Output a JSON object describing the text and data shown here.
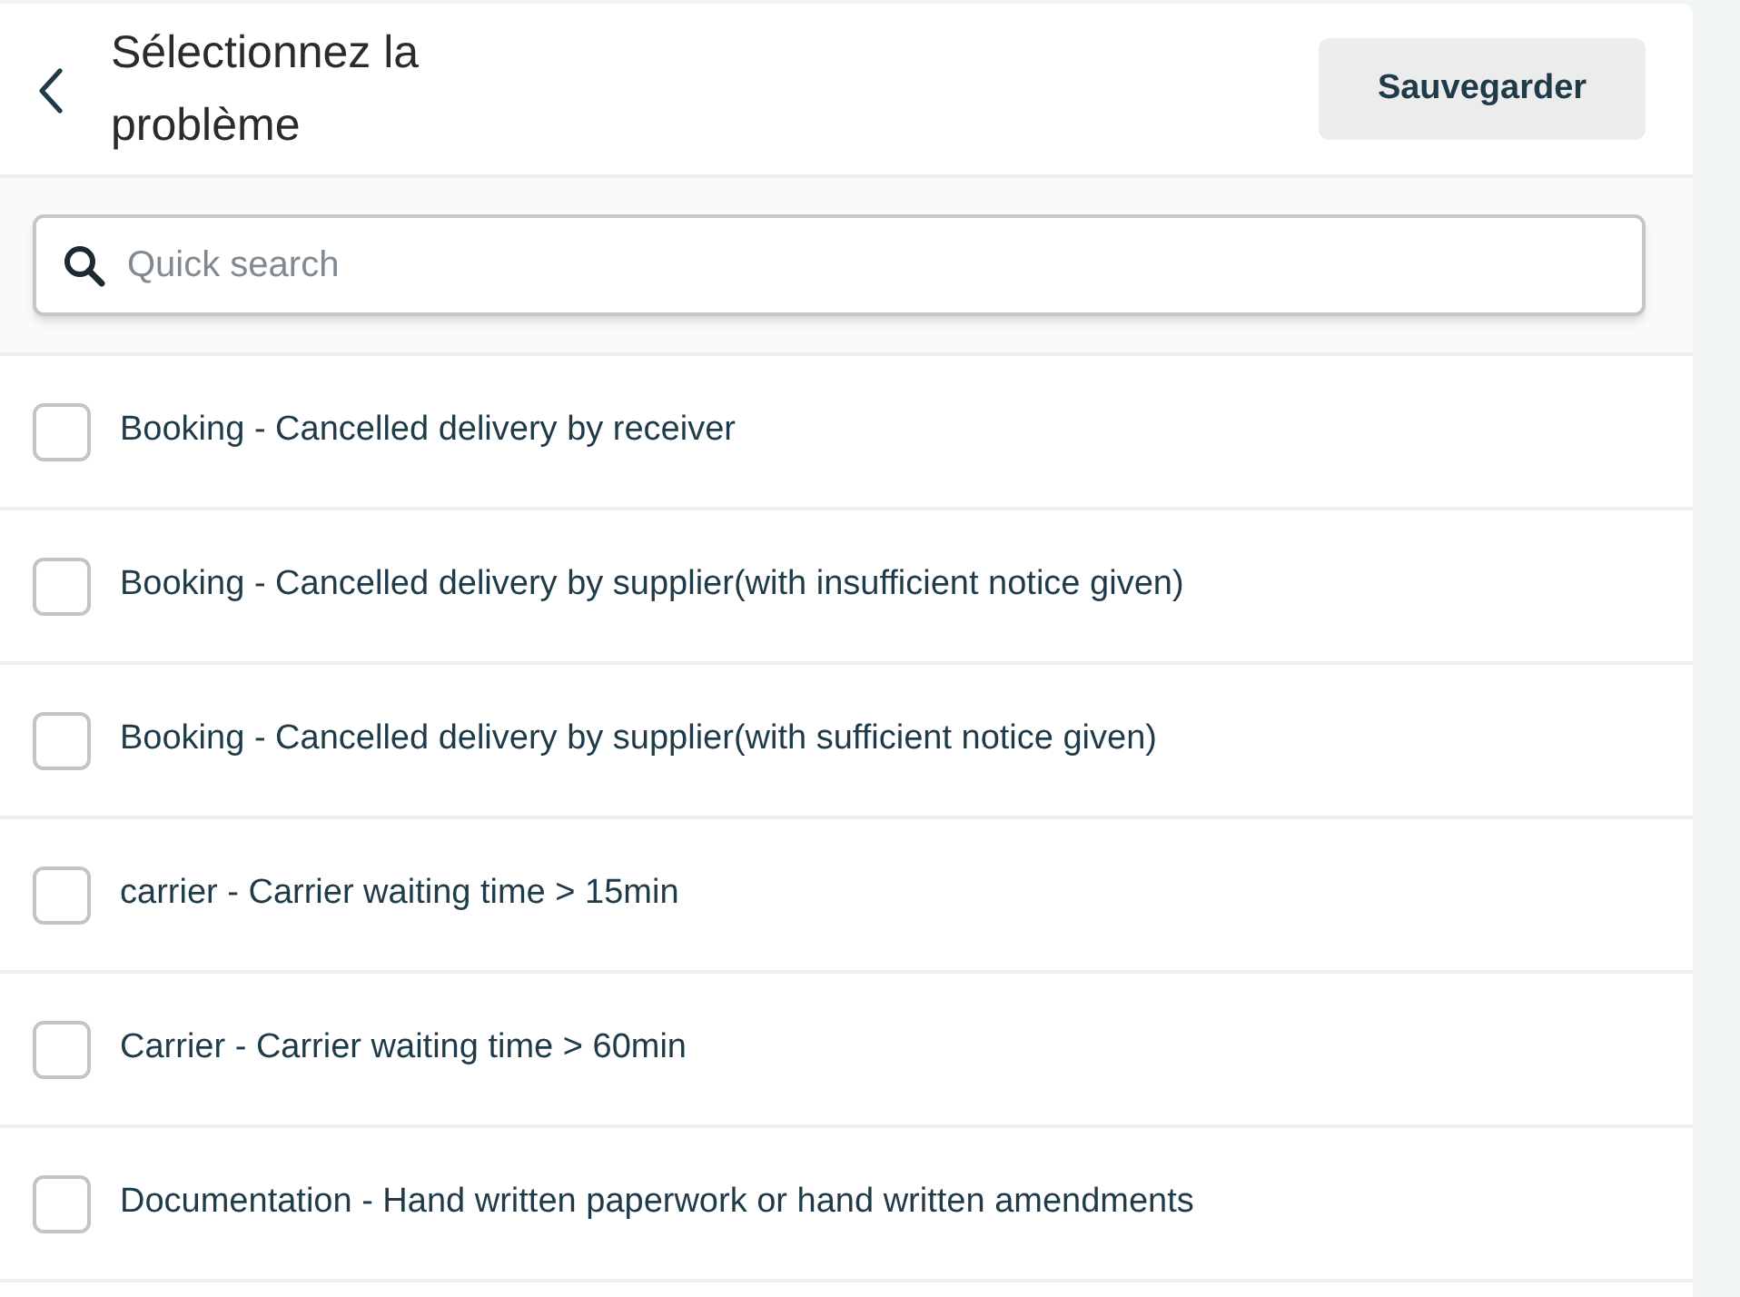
{
  "header": {
    "title": "Sélectionnez la problème",
    "save_button": "Sauvegarder"
  },
  "search": {
    "placeholder": "Quick search"
  },
  "options": [
    {
      "label": "Booking - Cancelled delivery by receiver",
      "checked": false
    },
    {
      "label": "Booking - Cancelled delivery by supplier(with insufficient notice given)",
      "checked": false
    },
    {
      "label": "Booking - Cancelled delivery by supplier(with sufficient notice given)",
      "checked": false
    },
    {
      "label": "carrier - Carrier waiting time > 15min",
      "checked": false
    },
    {
      "label": "Carrier - Carrier waiting time > 60min",
      "checked": false
    },
    {
      "label": "Documentation - Hand written paperwork or hand written amendments",
      "checked": false
    }
  ]
}
